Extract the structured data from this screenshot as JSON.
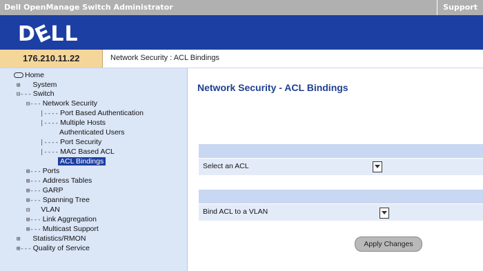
{
  "header": {
    "app_title": "Dell OpenManage Switch Administrator",
    "support_link": "Support",
    "logo_text": "DELL"
  },
  "infobar": {
    "ip": "176.210.11.22",
    "breadcrumb": "Network Security : ACL Bindings"
  },
  "sidebar": {
    "items": [
      {
        "label": "Home",
        "conn": ""
      },
      {
        "label": "System",
        "conn": "⊞"
      },
      {
        "label": "Switch",
        "conn": "⊟---"
      },
      {
        "label": "Network Security",
        "conn": "⊟---"
      },
      {
        "label": "Port Based Authentication",
        "conn": "|----"
      },
      {
        "label": "Multiple Hosts",
        "conn": "|----"
      },
      {
        "label": "Authenticated Users",
        "conn": ""
      },
      {
        "label": "Port Security",
        "conn": "|----"
      },
      {
        "label": "MAC Based ACL",
        "conn": "|----"
      },
      {
        "label": "ACL Bindings",
        "conn": ""
      },
      {
        "label": "Ports",
        "conn": "⊞---"
      },
      {
        "label": "Address Tables",
        "conn": "⊞---"
      },
      {
        "label": "GARP",
        "conn": "⊞---"
      },
      {
        "label": "Spanning Tree",
        "conn": "⊞---"
      },
      {
        "label": "VLAN",
        "conn": "⊟"
      },
      {
        "label": "Link Aggregation",
        "conn": "⊞---"
      },
      {
        "label": "Multicast Support",
        "conn": "⊞---"
      },
      {
        "label": "Statistics/RMON",
        "conn": "⊞"
      },
      {
        "label": "Quality of Service",
        "conn": "⊞---"
      }
    ]
  },
  "main": {
    "title": "Network Security - ACL Bindings",
    "select_acl_label": "Select an ACL",
    "bind_acl_label": "Bind ACL to a VLAN",
    "apply_label": "Apply Changes"
  }
}
